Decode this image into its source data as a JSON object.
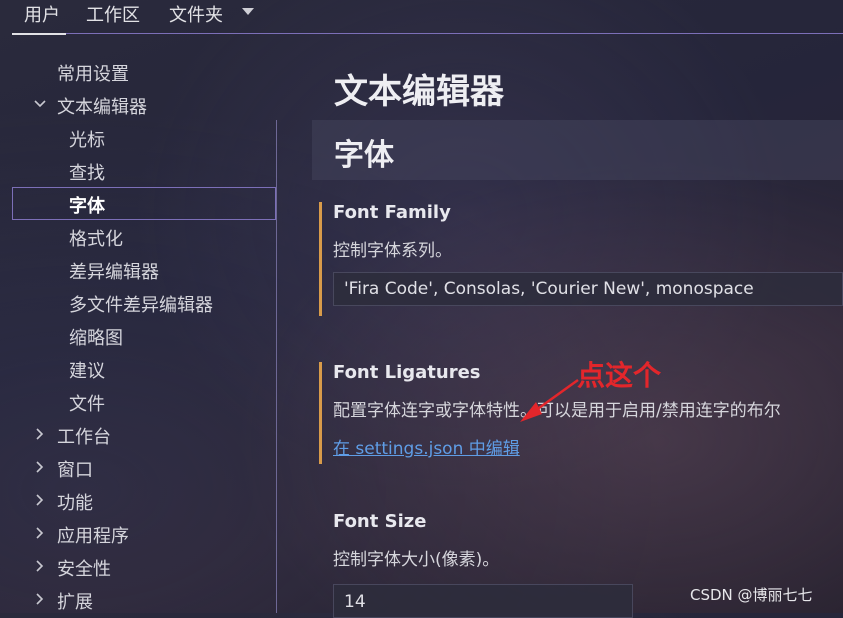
{
  "topbar": {
    "tabs": [
      {
        "label": "用户"
      },
      {
        "label": "工作区"
      },
      {
        "label": "文件夹"
      }
    ]
  },
  "sidebar": {
    "items": [
      {
        "label": "常用设置"
      },
      {
        "label": "文本编辑器"
      },
      {
        "label": "光标"
      },
      {
        "label": "查找"
      },
      {
        "label": "字体"
      },
      {
        "label": "格式化"
      },
      {
        "label": "差异编辑器"
      },
      {
        "label": "多文件差异编辑器"
      },
      {
        "label": "缩略图"
      },
      {
        "label": "建议"
      },
      {
        "label": "文件"
      },
      {
        "label": "工作台"
      },
      {
        "label": "窗口"
      },
      {
        "label": "功能"
      },
      {
        "label": "应用程序"
      },
      {
        "label": "安全性"
      },
      {
        "label": "扩展"
      }
    ]
  },
  "main": {
    "title": "文本编辑器",
    "section": "字体",
    "font_family": {
      "title": "Font Family",
      "description": "控制字体系列。",
      "value": "'Fira Code', Consolas, 'Courier New', monospace"
    },
    "font_ligatures": {
      "title": "Font Ligatures",
      "description": "配置字体连字或字体特性。可以是用于启用/禁用连字的布尔",
      "link": "在 settings.json 中编辑"
    },
    "font_size": {
      "title": "Font Size",
      "description": "控制字体大小(像素)。",
      "value": "14"
    }
  },
  "annotation": {
    "text": "点这个",
    "color": "#e3262b"
  },
  "watermark": "CSDN @博丽七七",
  "colors": {
    "accent": "#7c6fb8",
    "modified_bar": "#d89b4a",
    "link": "#5f9de6"
  }
}
